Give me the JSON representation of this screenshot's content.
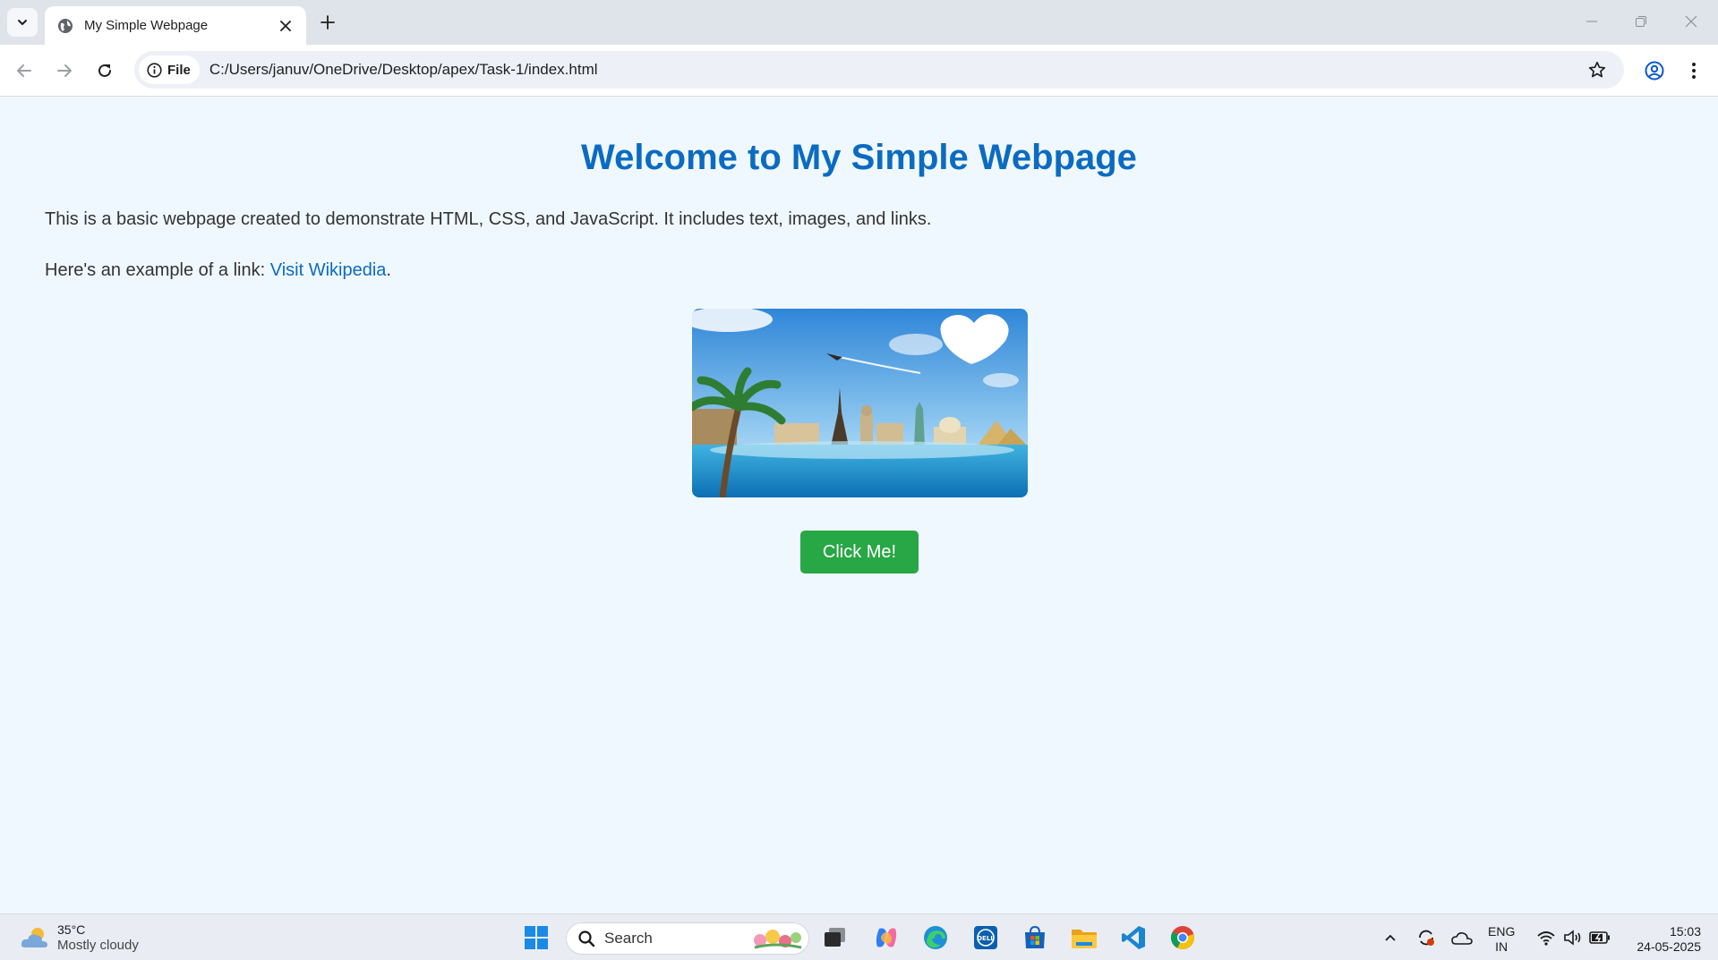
{
  "browser": {
    "tab_title": "My Simple Webpage",
    "chip_label": "File",
    "url": "C:/Users/januv/OneDrive/Desktop/apex/Task-1/index.html"
  },
  "page": {
    "heading": "Welcome to My Simple Webpage",
    "intro": "This is a basic webpage created to demonstrate HTML, CSS, and JavaScript. It includes text, images, and links.",
    "link_prefix": "Here's an example of a link: ",
    "link_text": "Visit Wikipedia",
    "link_suffix": ".",
    "button_label": "Click Me!",
    "accent_color": "#0b6bc2",
    "button_color": "#28a745"
  },
  "taskbar": {
    "weather_temp": "35°C",
    "weather_desc": "Mostly cloudy",
    "search_label": "Search",
    "lang_top": "ENG",
    "lang_bottom": "IN",
    "time": "15:03",
    "date": "24-05-2025",
    "pinned_icons": [
      "start-icon",
      "task-view-icon",
      "copilot-icon",
      "edge-icon",
      "dell-icon",
      "store-icon",
      "file-explorer-icon",
      "vscode-icon",
      "chrome-icon"
    ]
  }
}
